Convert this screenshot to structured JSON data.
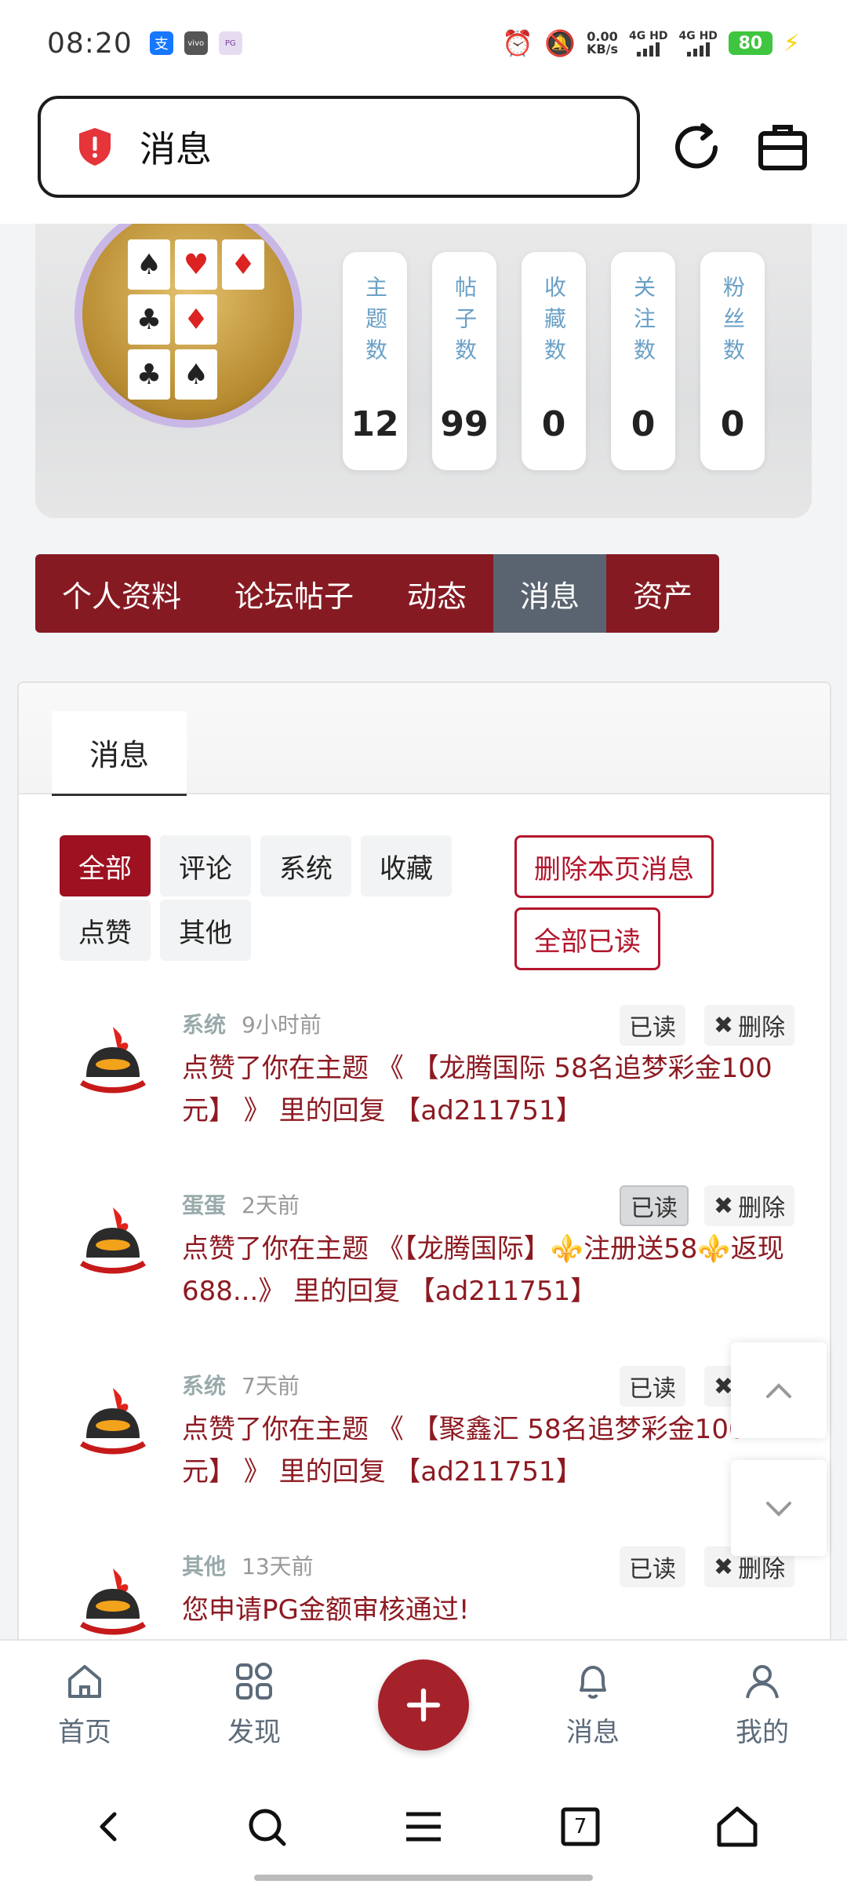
{
  "status_bar": {
    "time": "08:20",
    "net_speed": "0.00",
    "net_unit": "KB/s",
    "signal1": "4G HD",
    "signal2": "4G HD",
    "battery": "80"
  },
  "browser": {
    "address_text": "消息"
  },
  "profile": {
    "stats": [
      {
        "label": "主题数",
        "value": "12"
      },
      {
        "label": "帖子数",
        "value": "99"
      },
      {
        "label": "收藏数",
        "value": "0"
      },
      {
        "label": "关注数",
        "value": "0"
      },
      {
        "label": "粉丝数",
        "value": "0"
      }
    ]
  },
  "nav_tabs": [
    "个人资料",
    "论坛帖子",
    "动态",
    "消息",
    "资产"
  ],
  "panel": {
    "tab": "消息",
    "filters": [
      "全部",
      "评论",
      "系统",
      "收藏",
      "点赞",
      "其他"
    ],
    "delete_page": "删除本页消息",
    "mark_all_read": "全部已读",
    "read_label": "已读",
    "delete_label": "删除"
  },
  "messages": [
    {
      "from": "系统",
      "time": "9小时前",
      "text": "点赞了你在主题 《 【龙腾国际 58名追梦彩金100元】 》 里的回复 【ad211751】"
    },
    {
      "from": "蛋蛋",
      "time": "2天前",
      "text": "点赞了你在主题 《【龙腾国际】⚜️注册送58⚜️返现688...》 里的回复 【ad211751】"
    },
    {
      "from": "系统",
      "time": "7天前",
      "text": "点赞了你在主题 《 【聚鑫汇 58名追梦彩金100元】 》 里的回复 【ad211751】"
    },
    {
      "from": "其他",
      "time": "13天前",
      "text": "您申请PG金额审核通过!"
    }
  ],
  "app_nav": {
    "home": "首页",
    "discover": "发现",
    "messages": "消息",
    "mine": "我的"
  },
  "sys_nav": {
    "tab_count": "7"
  },
  "colors": {
    "brand": "#861a22",
    "active_tab": "#5a6470",
    "message_text": "#8d1a22"
  }
}
